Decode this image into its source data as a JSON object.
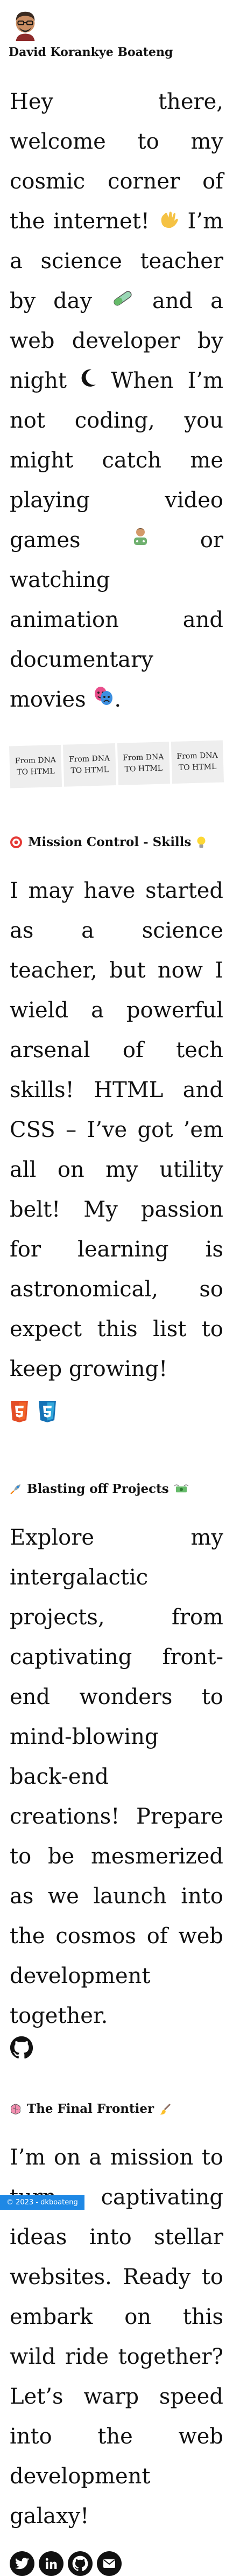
{
  "header": {
    "name": "David Korankye Boateng"
  },
  "intro": {
    "p1": "Hey there, welcome to my cosmic corner of the internet!",
    "p2": "I’m a science teacher by day",
    "p3": "and a web developer by night",
    "p4": "When I’m not coding, you might catch me playing video games",
    "p5": "or watching animation and documentary movies",
    "p6": "."
  },
  "ribbon": [
    "From DNA TO HTML",
    "From DNA TO HTML",
    "From DNA TO HTML",
    "From DNA TO HTML"
  ],
  "skills": {
    "title": "Mission Control - Skills",
    "body": "I may have started as a science teacher, but now I wield a powerful arsenal of tech skills! HTML and CSS – I’ve got ’em all on my utility belt! My passion for learning is astronomical, so expect this list to keep growing!",
    "badges": [
      "HTML5",
      "CSS3"
    ]
  },
  "projects": {
    "title": "Blasting off Projects",
    "body": "Explore my intergalactic projects, from captivating front-end wonders to mind-blowing back-end creations! Prepare to be mesmerized as we launch into the cosmos of web development together."
  },
  "frontier": {
    "title": "The Final Frontier",
    "body": "I’m on a mission to turn captivating ideas into stellar websites. Ready to embark on this wild ride together? Let’s warp speed into the web development galaxy!"
  },
  "footer": {
    "text": "© 2023 - dkboateng"
  },
  "colors": {
    "footer_bg": "#1e88e5",
    "ribbon_bg": "#eeeeee"
  }
}
